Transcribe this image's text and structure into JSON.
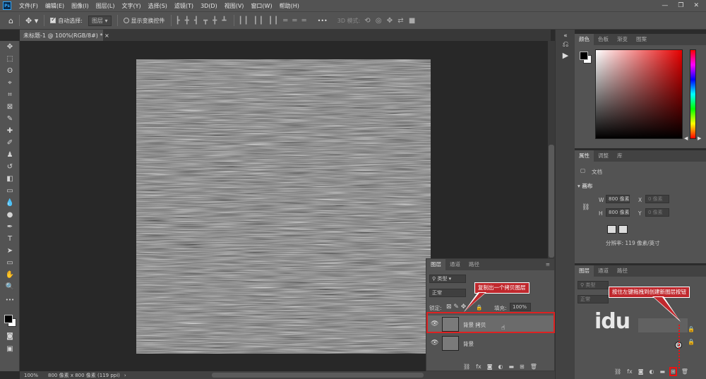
{
  "app": {
    "logo": "Ps"
  },
  "menu": [
    "文件(F)",
    "编辑(E)",
    "图像(I)",
    "图层(L)",
    "文字(Y)",
    "选择(S)",
    "滤镜(T)",
    "3D(D)",
    "视图(V)",
    "窗口(W)",
    "帮助(H)"
  ],
  "window_controls": {
    "minimize": "—",
    "restore": "❐",
    "close": "✕"
  },
  "options_bar": {
    "auto_select_label": "自动选择:",
    "auto_select_checked": true,
    "auto_select_target": "图层",
    "show_transform_label": "显示变换控件",
    "mode_3d_label": "3D 模式:",
    "more": "•••"
  },
  "document": {
    "tab_title": "未标题-1 @ 100%(RGB/8#) *",
    "close": "×"
  },
  "status": {
    "zoom": "100%",
    "size_info": "800 像素 x 800 像素 (119 ppi)"
  },
  "color_panel": {
    "tabs": [
      "颜色",
      "色板",
      "渐变",
      "图案"
    ],
    "active": 0
  },
  "properties_panel": {
    "tabs": [
      "属性",
      "调整",
      "库"
    ],
    "doc_label": "文档",
    "section": "画布",
    "w_label": "W",
    "w_value": "800 像素",
    "h_label": "H",
    "h_value": "800 像素",
    "x_label": "X",
    "x_value": "0 像素",
    "y_label": "Y",
    "y_value": "0 像素",
    "resolution": "分辨率: 119 像素/英寸"
  },
  "layers_right": {
    "tabs": [
      "图层",
      "通道",
      "路径"
    ],
    "filter_label": "类型",
    "blend_mode": "正常"
  },
  "layers_float": {
    "tabs": [
      "图层",
      "通道",
      "路径"
    ],
    "filter_label": "类型",
    "blend_mode": "正常",
    "lock_label": "锁定:",
    "fill_label": "填充:",
    "fill_value": "100%",
    "layers": [
      {
        "name": "背景 拷贝",
        "selected": true
      },
      {
        "name": "背景",
        "selected": false
      }
    ]
  },
  "callouts": {
    "copy_layer": "复制出一个拷贝图层",
    "drag_to_new": "按住左键拖拽到创建新图层按钮"
  },
  "watermark": "du"
}
